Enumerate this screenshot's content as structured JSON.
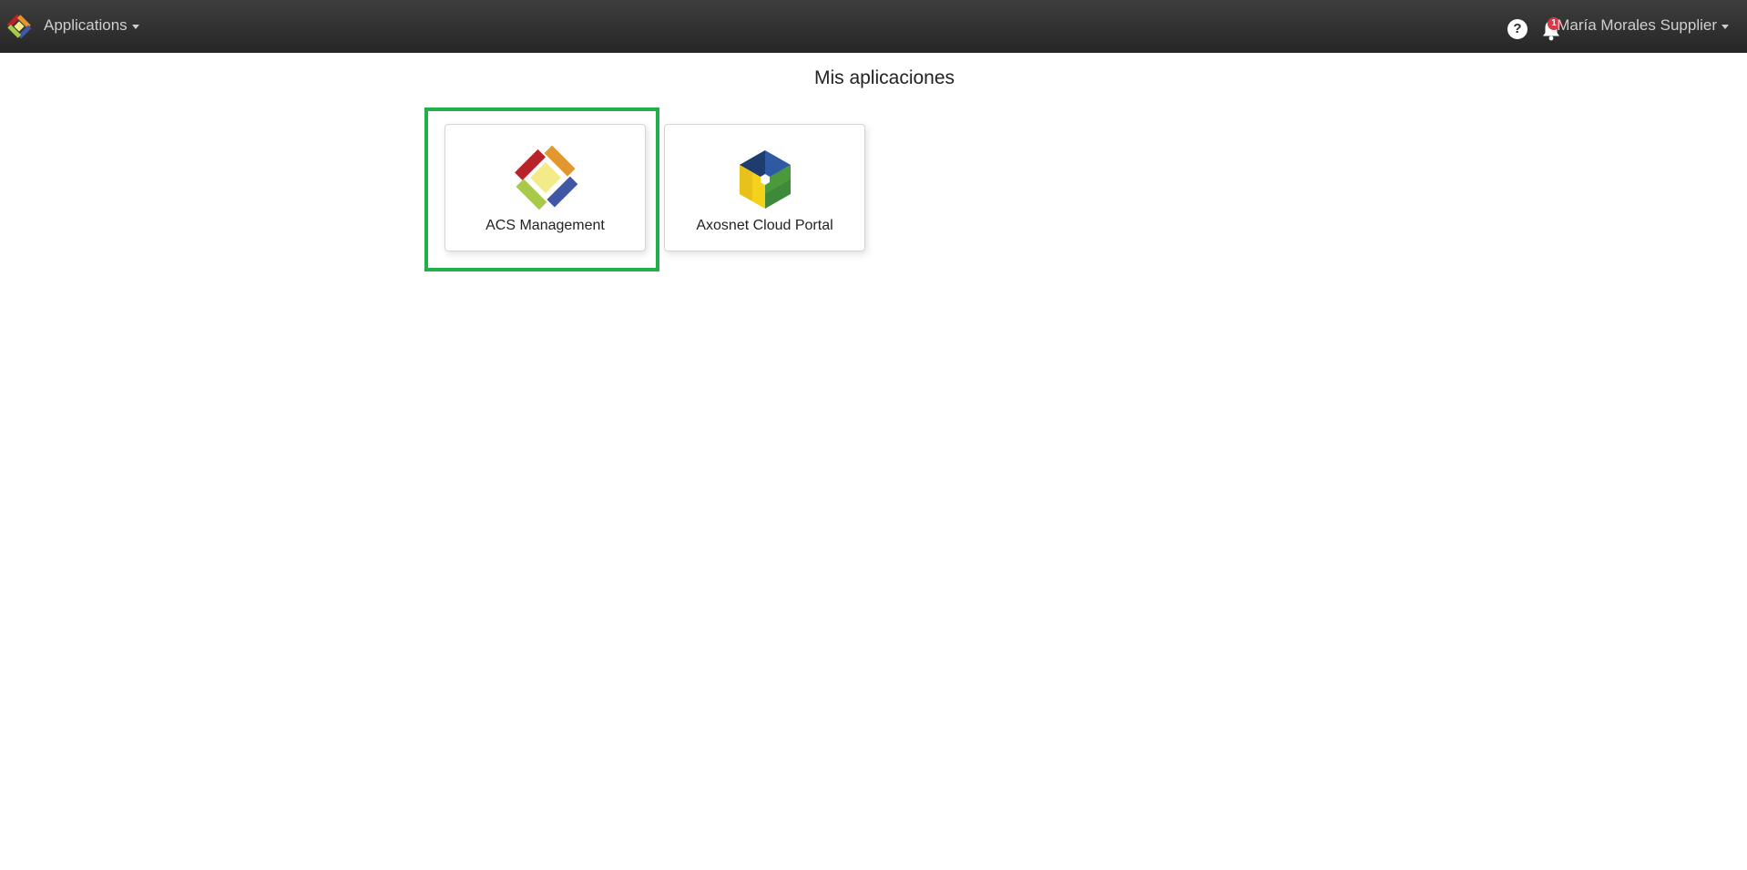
{
  "navbar": {
    "apps_label": "Applications",
    "help_glyph": "?",
    "notification_count": "1",
    "user_name": "María Morales Supplier"
  },
  "page": {
    "title": "Mis aplicaciones"
  },
  "apps": [
    {
      "label": "ACS Management",
      "icon": "acs-logo-icon",
      "selected": true
    },
    {
      "label": "Axosnet Cloud Portal",
      "icon": "axosnet-cube-icon",
      "selected": false
    }
  ],
  "colors": {
    "navbar_bg": "#2f2f2f",
    "highlight": "#20b04b",
    "badge": "#dc3545",
    "acs_red": "#b8222b",
    "acs_orange": "#e2962f",
    "acs_green": "#a9c94a",
    "acs_blue": "#3f57a5",
    "acs_yellow": "#f3eb88",
    "cube_blue_top": "#2d5aa3",
    "cube_navy": "#1f3c6e",
    "cube_yellow": "#f4d11a",
    "cube_green": "#3e8a3a"
  }
}
